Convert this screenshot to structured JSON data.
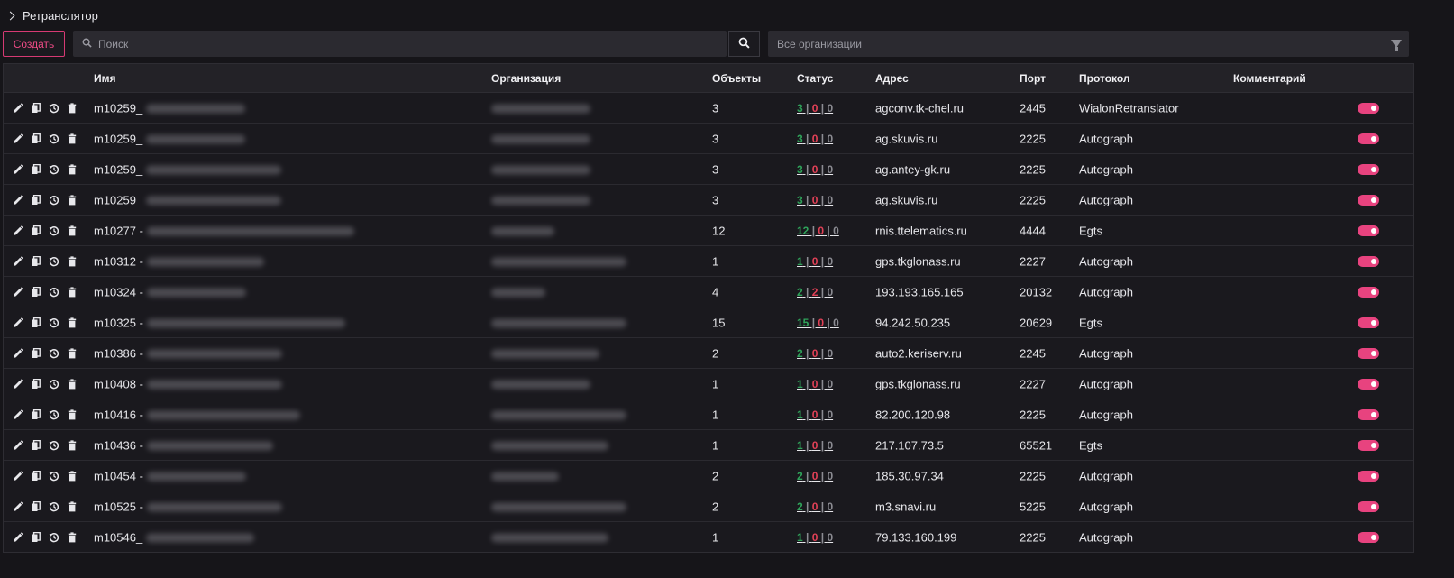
{
  "breadcrumb": {
    "title": "Ретранслятор"
  },
  "toolbar": {
    "create_label": "Создать",
    "search_placeholder": "Поиск",
    "org_filter": "Все организации"
  },
  "table": {
    "headers": {
      "name": "Имя",
      "org": "Организация",
      "objects": "Объекты",
      "status": "Статус",
      "address": "Адрес",
      "port": "Порт",
      "protocol": "Протокол",
      "comment": "Комментарий"
    },
    "rows": [
      {
        "name": "m10259_",
        "objects": "3",
        "s1": "3",
        "s2": "0",
        "s3": "0",
        "address": "agconv.tk-chel.ru",
        "port": "2445",
        "protocol": "WialonRetranslator",
        "enabled": true
      },
      {
        "name": "m10259_",
        "objects": "3",
        "s1": "3",
        "s2": "0",
        "s3": "0",
        "address": "ag.skuvis.ru",
        "port": "2225",
        "protocol": "Autograph",
        "enabled": true
      },
      {
        "name": "m10259_",
        "objects": "3",
        "s1": "3",
        "s2": "0",
        "s3": "0",
        "address": "ag.antey-gk.ru",
        "port": "2225",
        "protocol": "Autograph",
        "enabled": true
      },
      {
        "name": "m10259_",
        "objects": "3",
        "s1": "3",
        "s2": "0",
        "s3": "0",
        "address": "ag.skuvis.ru",
        "port": "2225",
        "protocol": "Autograph",
        "enabled": true
      },
      {
        "name": "m10277 -",
        "objects": "12",
        "s1": "12",
        "s2": "0",
        "s3": "0",
        "address": "rnis.ttelematics.ru",
        "port": "4444",
        "protocol": "Egts",
        "enabled": true
      },
      {
        "name": "m10312 -",
        "objects": "1",
        "s1": "1",
        "s2": "0",
        "s3": "0",
        "address": "gps.tkglonass.ru",
        "port": "2227",
        "protocol": "Autograph",
        "enabled": true
      },
      {
        "name": "m10324 -",
        "objects": "4",
        "s1": "2",
        "s2": "2",
        "s3": "0",
        "address": "193.193.165.165",
        "port": "20132",
        "protocol": "Autograph",
        "enabled": true
      },
      {
        "name": "m10325 -",
        "objects": "15",
        "s1": "15",
        "s2": "0",
        "s3": "0",
        "address": "94.242.50.235",
        "port": "20629",
        "protocol": "Egts",
        "enabled": true
      },
      {
        "name": "m10386 -",
        "objects": "2",
        "s1": "2",
        "s2": "0",
        "s3": "0",
        "address": "auto2.keriserv.ru",
        "port": "2245",
        "protocol": "Autograph",
        "enabled": true
      },
      {
        "name": "m10408 -",
        "objects": "1",
        "s1": "1",
        "s2": "0",
        "s3": "0",
        "address": "gps.tkglonass.ru",
        "port": "2227",
        "protocol": "Autograph",
        "enabled": true
      },
      {
        "name": "m10416 -",
        "objects": "1",
        "s1": "1",
        "s2": "0",
        "s3": "0",
        "address": "82.200.120.98",
        "port": "2225",
        "protocol": "Autograph",
        "enabled": true
      },
      {
        "name": "m10436 -",
        "objects": "1",
        "s1": "1",
        "s2": "0",
        "s3": "0",
        "address": "217.107.73.5",
        "port": "65521",
        "protocol": "Egts",
        "enabled": true
      },
      {
        "name": "m10454 -",
        "objects": "2",
        "s1": "2",
        "s2": "0",
        "s3": "0",
        "address": "185.30.97.34",
        "port": "2225",
        "protocol": "Autograph",
        "enabled": true
      },
      {
        "name": "m10525 -",
        "objects": "2",
        "s1": "2",
        "s2": "0",
        "s3": "0",
        "address": "m3.snavi.ru",
        "port": "5225",
        "protocol": "Autograph",
        "enabled": true
      },
      {
        "name": "m10546_",
        "objects": "1",
        "s1": "1",
        "s2": "0",
        "s3": "0",
        "address": "79.133.160.199",
        "port": "2225",
        "protocol": "Autograph",
        "enabled": true
      }
    ]
  },
  "colors": {
    "accent": "#e8437f",
    "status_ok": "#2fa35a",
    "status_err": "#e24157",
    "status_off": "#8c8c93",
    "background": "#161519"
  },
  "icons": [
    "chevron-right-icon",
    "search-icon",
    "filter-icon",
    "edit-icon",
    "copy-icon",
    "history-icon",
    "delete-icon"
  ]
}
